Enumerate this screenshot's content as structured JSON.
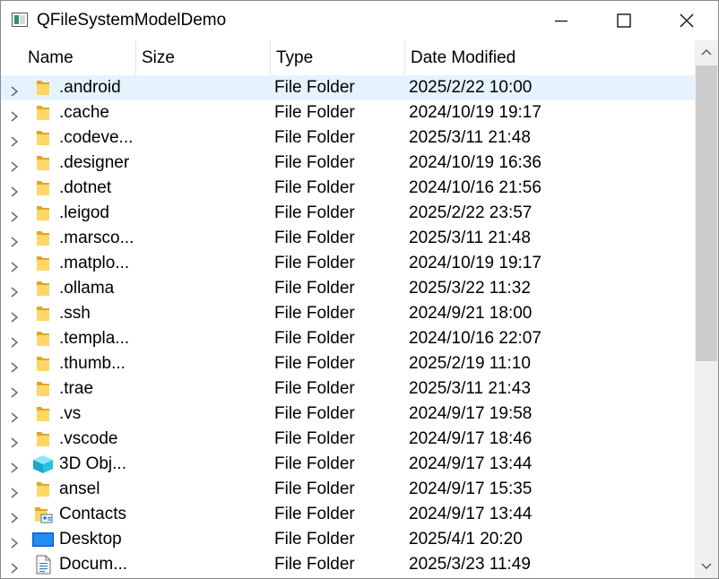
{
  "window": {
    "title": "QFileSystemModelDemo",
    "controls": {
      "minimize": "minimize-icon",
      "maximize": "maximize-icon",
      "close": "close-icon"
    }
  },
  "header": {
    "name": "Name",
    "size": "Size",
    "type": "Type",
    "date": "Date Modified"
  },
  "rows": [
    {
      "name": ".android",
      "type": "File Folder",
      "date": "2025/2/22 10:00",
      "icon": "folder-icon",
      "selected": true
    },
    {
      "name": ".cache",
      "type": "File Folder",
      "date": "2024/10/19 19:17",
      "icon": "folder-icon"
    },
    {
      "name": ".codeve...",
      "type": "File Folder",
      "date": "2025/3/11 21:48",
      "icon": "folder-icon"
    },
    {
      "name": ".designer",
      "type": "File Folder",
      "date": "2024/10/19 16:36",
      "icon": "folder-icon"
    },
    {
      "name": ".dotnet",
      "type": "File Folder",
      "date": "2024/10/16 21:56",
      "icon": "folder-icon"
    },
    {
      "name": ".leigod",
      "type": "File Folder",
      "date": "2025/2/22 23:57",
      "icon": "folder-icon"
    },
    {
      "name": ".marsco...",
      "type": "File Folder",
      "date": "2025/3/11 21:48",
      "icon": "folder-icon"
    },
    {
      "name": ".matplo...",
      "type": "File Folder",
      "date": "2024/10/19 19:17",
      "icon": "folder-icon"
    },
    {
      "name": ".ollama",
      "type": "File Folder",
      "date": "2025/3/22 11:32",
      "icon": "folder-icon"
    },
    {
      "name": ".ssh",
      "type": "File Folder",
      "date": "2024/9/21 18:00",
      "icon": "folder-icon"
    },
    {
      "name": ".templa...",
      "type": "File Folder",
      "date": "2024/10/16 22:07",
      "icon": "folder-icon"
    },
    {
      "name": ".thumb...",
      "type": "File Folder",
      "date": "2025/2/19 11:10",
      "icon": "folder-icon"
    },
    {
      "name": ".trae",
      "type": "File Folder",
      "date": "2025/3/11 21:43",
      "icon": "folder-icon"
    },
    {
      "name": ".vs",
      "type": "File Folder",
      "date": "2024/9/17 19:58",
      "icon": "folder-icon"
    },
    {
      "name": ".vscode",
      "type": "File Folder",
      "date": "2024/9/17 18:46",
      "icon": "folder-icon"
    },
    {
      "name": "3D Obj...",
      "type": "File Folder",
      "date": "2024/9/17 13:44",
      "icon": "3d-objects-icon"
    },
    {
      "name": "ansel",
      "type": "File Folder",
      "date": "2024/9/17 15:35",
      "icon": "folder-icon"
    },
    {
      "name": "Contacts",
      "type": "File Folder",
      "date": "2024/9/17 13:44",
      "icon": "contacts-folder-icon"
    },
    {
      "name": "Desktop",
      "type": "File Folder",
      "date": "2025/4/1 20:20",
      "icon": "desktop-icon"
    },
    {
      "name": "Docum...",
      "type": "File Folder",
      "date": "2025/3/23 11:49",
      "icon": "documents-icon"
    }
  ]
}
